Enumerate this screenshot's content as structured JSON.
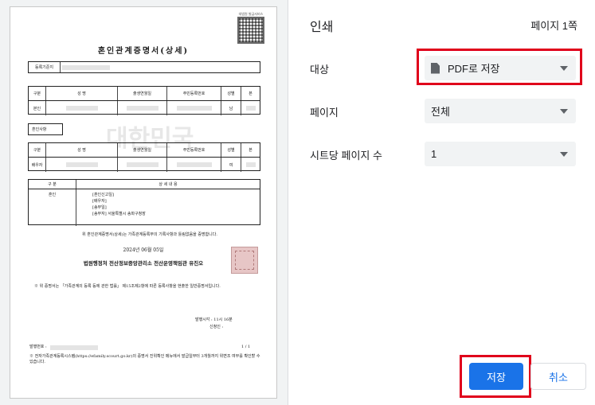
{
  "preview": {
    "qr_caption": "대법원 발급서비스",
    "doc_title": "혼인관계증명서(상세)",
    "field_registry": "등록기준지",
    "header_cols": [
      "구분",
      "성 명",
      "출생연월일",
      "주민등록번호",
      "성별",
      "본"
    ],
    "self_label": "본인",
    "self_sex": "남",
    "marriage_section": "혼인사항",
    "spouse_label": "배우자",
    "spouse_sex": "여",
    "detail_header": [
      "구 분",
      "상 세 내 용"
    ],
    "detail_label": "혼인",
    "detail_items": [
      "[혼인신고일]",
      "[배우자]",
      "[송부일]",
      "[송부자] 서울특별시 송파구청장"
    ],
    "cert_sentence": "위 혼인관계증명서(상세)는 가족관계등록부의 기록사항과 틀림없음을 증명합니다.",
    "date": "2024년 06월 05일",
    "issuer": "법원행정처 전산정보중앙관리소 전산운영책임관 유진오",
    "note": "※ 위 증명서는 「가족관계의 등록 등에 관한 법률」 제15조제2항에 따른 등록사항을 현출한 일반증명서입니다.",
    "issue_time": "발행시각 : 11시 16분",
    "issuer2": "신청인 :",
    "cert_no": "발행번호 :",
    "page_no": "1 / 1",
    "footer": "※ 전자가족관계등록시스템(https://efamily.scourt.go.kr)의 증명서 진위확인 메뉴에서 발급일부터 3개월까지 위변조 여부를 확인할 수 있습니다.",
    "watermark": "대한민국"
  },
  "settings": {
    "title": "인쇄",
    "page_count": "페이지 1쪽",
    "destination_label": "대상",
    "destination_value": "PDF로 저장",
    "pages_label": "페이지",
    "pages_value": "전체",
    "pps_label": "시트당 페이지 수",
    "pps_value": "1",
    "save_label": "저장",
    "cancel_label": "취소"
  },
  "colors": {
    "accent": "#1a73e8",
    "highlight": "#e0001b"
  },
  "icons": {
    "destination": "pdf-file-icon",
    "dropdown": "chevron-down-icon"
  }
}
